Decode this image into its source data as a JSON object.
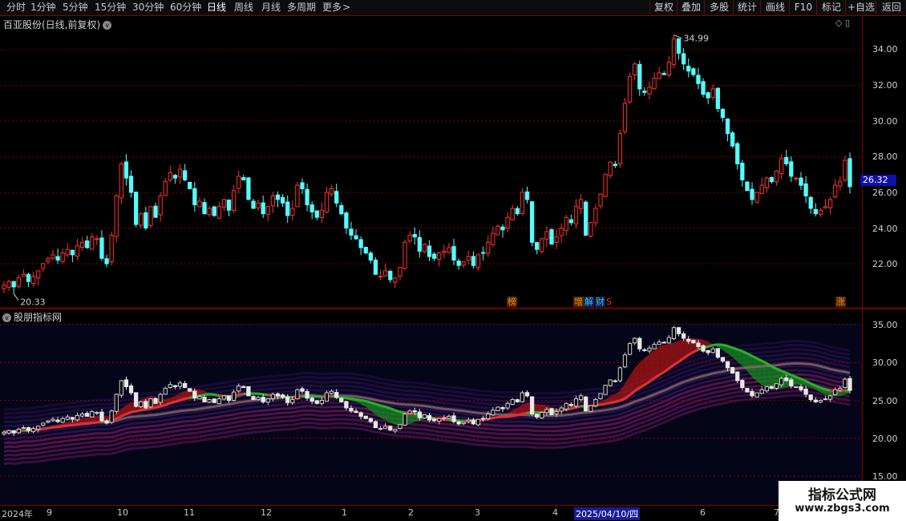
{
  "toolbar": {
    "periods": [
      "分时",
      "1分钟",
      "5分钟",
      "15分钟",
      "30分钟",
      "60分钟",
      "日线",
      "周线",
      "月线",
      "多周期",
      "更多"
    ],
    "active_period": "日线",
    "more_arrow": ">",
    "right_buttons": [
      "复权",
      "叠加",
      "多股",
      "统计",
      "画线",
      "F10",
      "标记",
      "+自选",
      "返回"
    ]
  },
  "main_panel": {
    "title": "百亚股份(日线,前复权)",
    "title_arrow": "v",
    "top_icons": "◇ ▯",
    "y_ticks": [
      "34.00",
      "32.00",
      "30.00",
      "28.00",
      "26.00",
      "24.00",
      "22.00"
    ],
    "current_price": "26.32",
    "max_label": "34.99",
    "min_label": "20.33",
    "badges": [
      {
        "text": "榜",
        "color": "#ff8a1a"
      },
      {
        "text": "增",
        "color": "#ff8a1a"
      },
      {
        "text": "解",
        "color": "#4fb3ff"
      },
      {
        "text": "财",
        "color": "#4fb3ff"
      },
      {
        "text": "S",
        "color": "#ff3030"
      },
      {
        "text": "涨",
        "color": "#ff8a1a"
      }
    ]
  },
  "indicator_panel": {
    "title": "股朋指标网",
    "y_ticks": [
      "35.00",
      "30.00",
      "25.00",
      "20.00",
      "15.00"
    ]
  },
  "x_axis": {
    "labels": [
      "2024年",
      "9",
      "10",
      "11",
      "12",
      "1",
      "2",
      "3",
      "4",
      "2025/04/10/四",
      "6",
      "7"
    ]
  },
  "watermark": {
    "line1": "指标公式网",
    "line2": "www.zbgs3.com"
  },
  "colors": {
    "up": "#ff3232",
    "down": "#54ffff",
    "grid": "#8a0000",
    "ma_red": "#e03030",
    "ma_green": "#26b326",
    "ma_brown": "#8a6a6a"
  },
  "chart_data": {
    "type": "candlestick",
    "title": "百亚股份(日线,前复权)",
    "ylim": [
      20.3,
      35.3
    ],
    "x_axis_months": [
      "2024年",
      "9",
      "10",
      "11",
      "12",
      "1",
      "2",
      "3",
      "4",
      "2025/04/10/四",
      "6",
      "7"
    ],
    "annotations": {
      "high": "34.99",
      "low": "20.33",
      "last": "26.32"
    },
    "closes": [
      20.8,
      21.0,
      20.7,
      21.2,
      21.4,
      21.0,
      21.3,
      21.6,
      22.0,
      22.3,
      22.5,
      22.2,
      22.6,
      22.8,
      22.5,
      23.0,
      23.2,
      22.9,
      23.5,
      23.4,
      22.3,
      22.0,
      23.6,
      25.8,
      27.6,
      26.8,
      26.0,
      24.2,
      24.8,
      24.0,
      25.2,
      24.6,
      25.8,
      26.6,
      27.1,
      26.8,
      27.3,
      26.7,
      26.2,
      25.3,
      25.5,
      24.8,
      25.1,
      24.7,
      25.2,
      25.6,
      25.0,
      26.1,
      26.9,
      26.7,
      25.6,
      25.1,
      25.4,
      24.8,
      25.2,
      25.8,
      25.6,
      25.4,
      24.7,
      25.1,
      26.4,
      26.2,
      25.3,
      24.9,
      24.6,
      25.0,
      26.0,
      26.2,
      25.4,
      24.8,
      24.0,
      23.6,
      23.4,
      22.9,
      22.6,
      22.2,
      21.4,
      21.3,
      21.6,
      21.1,
      21.2,
      21.8,
      23.2,
      23.6,
      23.5,
      22.7,
      23.1,
      22.4,
      22.3,
      22.6,
      22.7,
      22.9,
      22.2,
      21.9,
      22.1,
      22.4,
      21.9,
      22.5,
      22.6,
      23.2,
      23.7,
      24.1,
      23.9,
      24.6,
      25.1,
      24.8,
      26.0,
      25.6,
      23.2,
      22.8,
      23.4,
      23.8,
      23.1,
      23.5,
      24.0,
      24.6,
      24.3,
      25.2,
      25.6,
      23.6,
      24.3,
      25.1,
      25.9,
      27.0,
      27.7,
      27.5,
      29.3,
      31.0,
      32.5,
      33.2,
      31.8,
      31.6,
      31.9,
      32.4,
      32.7,
      32.6,
      33.3,
      34.6,
      33.8,
      33.2,
      32.8,
      32.6,
      32.1,
      31.5,
      31.3,
      31.8,
      30.7,
      30.2,
      29.3,
      28.6,
      27.6,
      26.7,
      26.1,
      25.6,
      26.0,
      26.4,
      26.8,
      26.6,
      27.2,
      27.9,
      27.6,
      26.9,
      26.8,
      26.4,
      25.8,
      25.1,
      24.8,
      25.0,
      25.2,
      25.6,
      26.4,
      26.6,
      27.8,
      26.32
    ]
  }
}
